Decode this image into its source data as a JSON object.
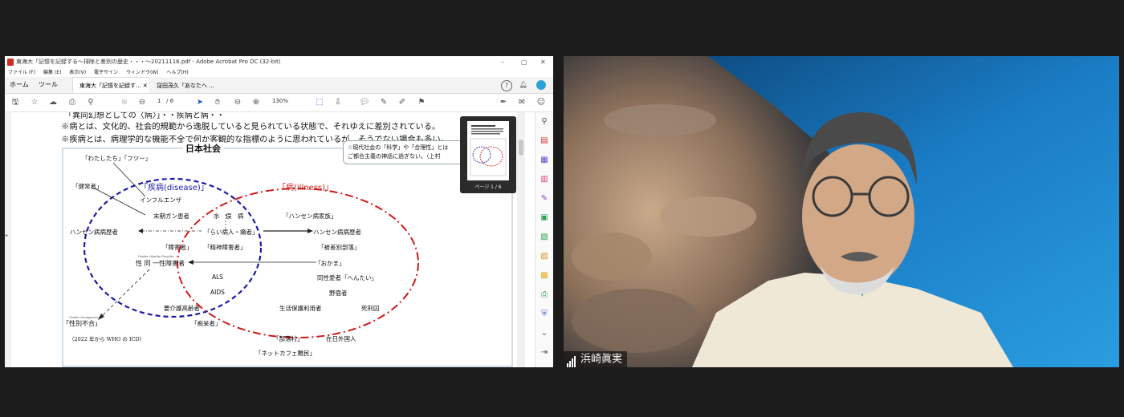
{
  "acrobat": {
    "title": "東海大「記憶を記録する～排除と差別の歴史・・・～20211116.pdf - Adobe Acrobat Pro DC (32-bit)",
    "menu": [
      "ファイル (F)",
      "編集 (E)",
      "表示(V)",
      "電子サイン",
      "ウィンドウ(W)",
      "ヘルプ(H)"
    ],
    "tabs": {
      "home": "ホーム",
      "tools": "ツール",
      "doc1": "東海大「記憶を記録す...",
      "doc2": "窪田茂久「あなたへ ..."
    },
    "page_current": "1",
    "page_total": "/ 6",
    "zoom": "130%",
    "thumb_label": "ページ 1 / 6"
  },
  "document": {
    "heading_partial": "「異同幻想としての〈病〉」・・疾病と病・・",
    "line1": "※病とは、文化的、社会的規範から逸脱していると見られている状態で、それゆえに差別されている。",
    "line2": "※疾病とは、病理学的な機能不全で何か客観的な指標のように思われているが、そうでない場合も多い。",
    "society_label": "日本社会",
    "note": [
      "☆現代社会の「科学」や「合理性」とは",
      "ご都合主義の神話に過ぎない。（上村"
    ],
    "disease_label": "「疾病(disease)」",
    "illness_label": "「病(illness)」",
    "labels": {
      "watashitachi": "「わたしたち」「フツー」",
      "kenjosha": "「健常者」",
      "influenza": "インフルエンザ",
      "cancer": "末期ガン患者",
      "minamata": "水　俣　病",
      "hansen_family": "「ハンセン病家族」",
      "hansen_history_left": "ハンセン病病歴者",
      "rai": "「らい病人・癩者」",
      "hansen_history_right": "ハンセン病病歴者",
      "shogaisha": "「障害者」",
      "seishin": "「精神障害者」",
      "hisabetsu": "「被差別部落」",
      "seidoitsu": "性 同 一性障害者",
      "okama": "「おかま」",
      "als": "ALS",
      "aids": "AIDS",
      "doseiai": "同性愛者「へんたい」",
      "nojuku": "野宿者",
      "kaigo": "要介護高齢者",
      "seikatsu": "生活保護利用者",
      "shikei": "死刑囚",
      "seibetsu": "「性別不合」",
      "icd": "（2022 年から WHO の ICD）",
      "chihosha": "「痴呆者」",
      "sabetsu_mura": "「部落村」",
      "zainichi": "在日外国人",
      "netcafe": "「ネットカフェ難民」",
      "gender_dysphoria_small": "Gender Identity Disorder",
      "gender_incongruence_small": "Gender Incongruence"
    }
  },
  "participant": {
    "name": "浜崎眞実"
  },
  "colors": {
    "disease": "#1a1aa8",
    "illness": "#d01818",
    "background": "#1b1b1b"
  }
}
